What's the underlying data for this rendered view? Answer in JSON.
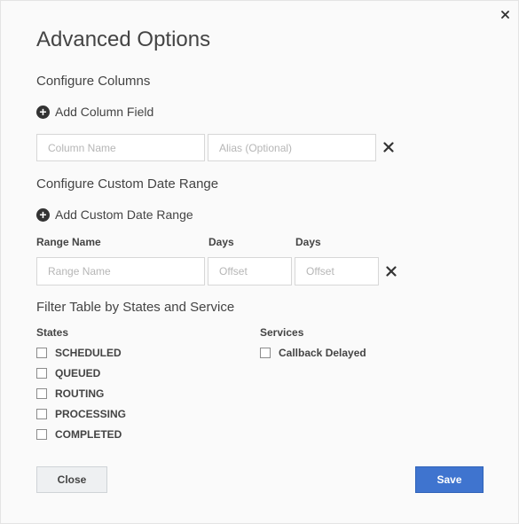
{
  "dialog": {
    "title": "Advanced Options",
    "close_icon": "close-icon"
  },
  "columns": {
    "section_title": "Configure Columns",
    "add_label": "Add Column Field",
    "column_name_placeholder": "Column Name",
    "alias_placeholder": "Alias (Optional)"
  },
  "date_range": {
    "section_title": "Configure Custom Date Range",
    "add_label": "Add Custom Date Range",
    "range_name_header": "Range Name",
    "days_header_1": "Days",
    "days_header_2": "Days",
    "range_name_placeholder": "Range Name",
    "offset_placeholder_1": "Offset",
    "offset_placeholder_2": "Offset"
  },
  "filter": {
    "section_title": "Filter Table by States and Service",
    "states_header": "States",
    "services_header": "Services",
    "states": [
      "SCHEDULED",
      "QUEUED",
      "ROUTING",
      "PROCESSING",
      "COMPLETED"
    ],
    "services": [
      "Callback Delayed"
    ]
  },
  "footer": {
    "close_label": "Close",
    "save_label": "Save"
  },
  "colors": {
    "accent": "#3f74cf",
    "background": "#fafafa"
  }
}
